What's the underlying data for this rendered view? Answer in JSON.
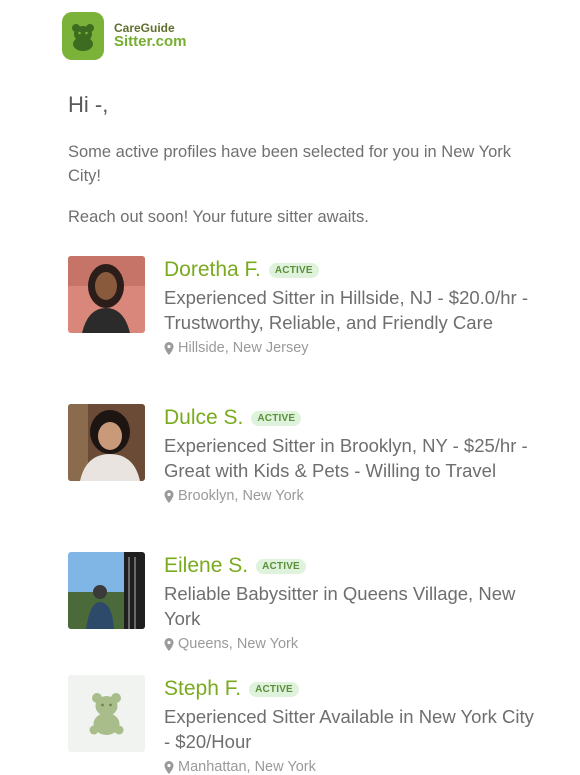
{
  "brand": {
    "line1": "CareGuide",
    "line2": "Sitter.com",
    "color": "#7ab23a"
  },
  "greeting": "Hi -,",
  "intro": "Some active profiles have been selected for you in New York City!",
  "cta": "Reach out soon! Your future sitter awaits.",
  "profiles": [
    {
      "name": "Doretha F.",
      "badge": "ACTIVE",
      "headline": "Experienced Sitter in Hillside, NJ - $20.0/hr - Trustworthy, Reliable, and Friendly Care",
      "location": "Hillside, New Jersey",
      "photo_icon": "user-photo"
    },
    {
      "name": "Dulce S.",
      "badge": "ACTIVE",
      "headline": "Experienced Sitter in Brooklyn, NY - $25/hr - Great with Kids & Pets - Willing to Travel",
      "location": "Brooklyn, New York",
      "photo_icon": "user-photo"
    },
    {
      "name": "Eilene S.",
      "badge": "ACTIVE",
      "headline": "Reliable Babysitter in Queens Village, New York",
      "location": "Queens, New York",
      "photo_icon": "user-photo"
    },
    {
      "name": "Steph F.",
      "badge": "ACTIVE",
      "headline": "Experienced Sitter Available in New York City - $20/Hour",
      "location": "Manhattan, New York",
      "photo_icon": "bear-placeholder"
    }
  ]
}
